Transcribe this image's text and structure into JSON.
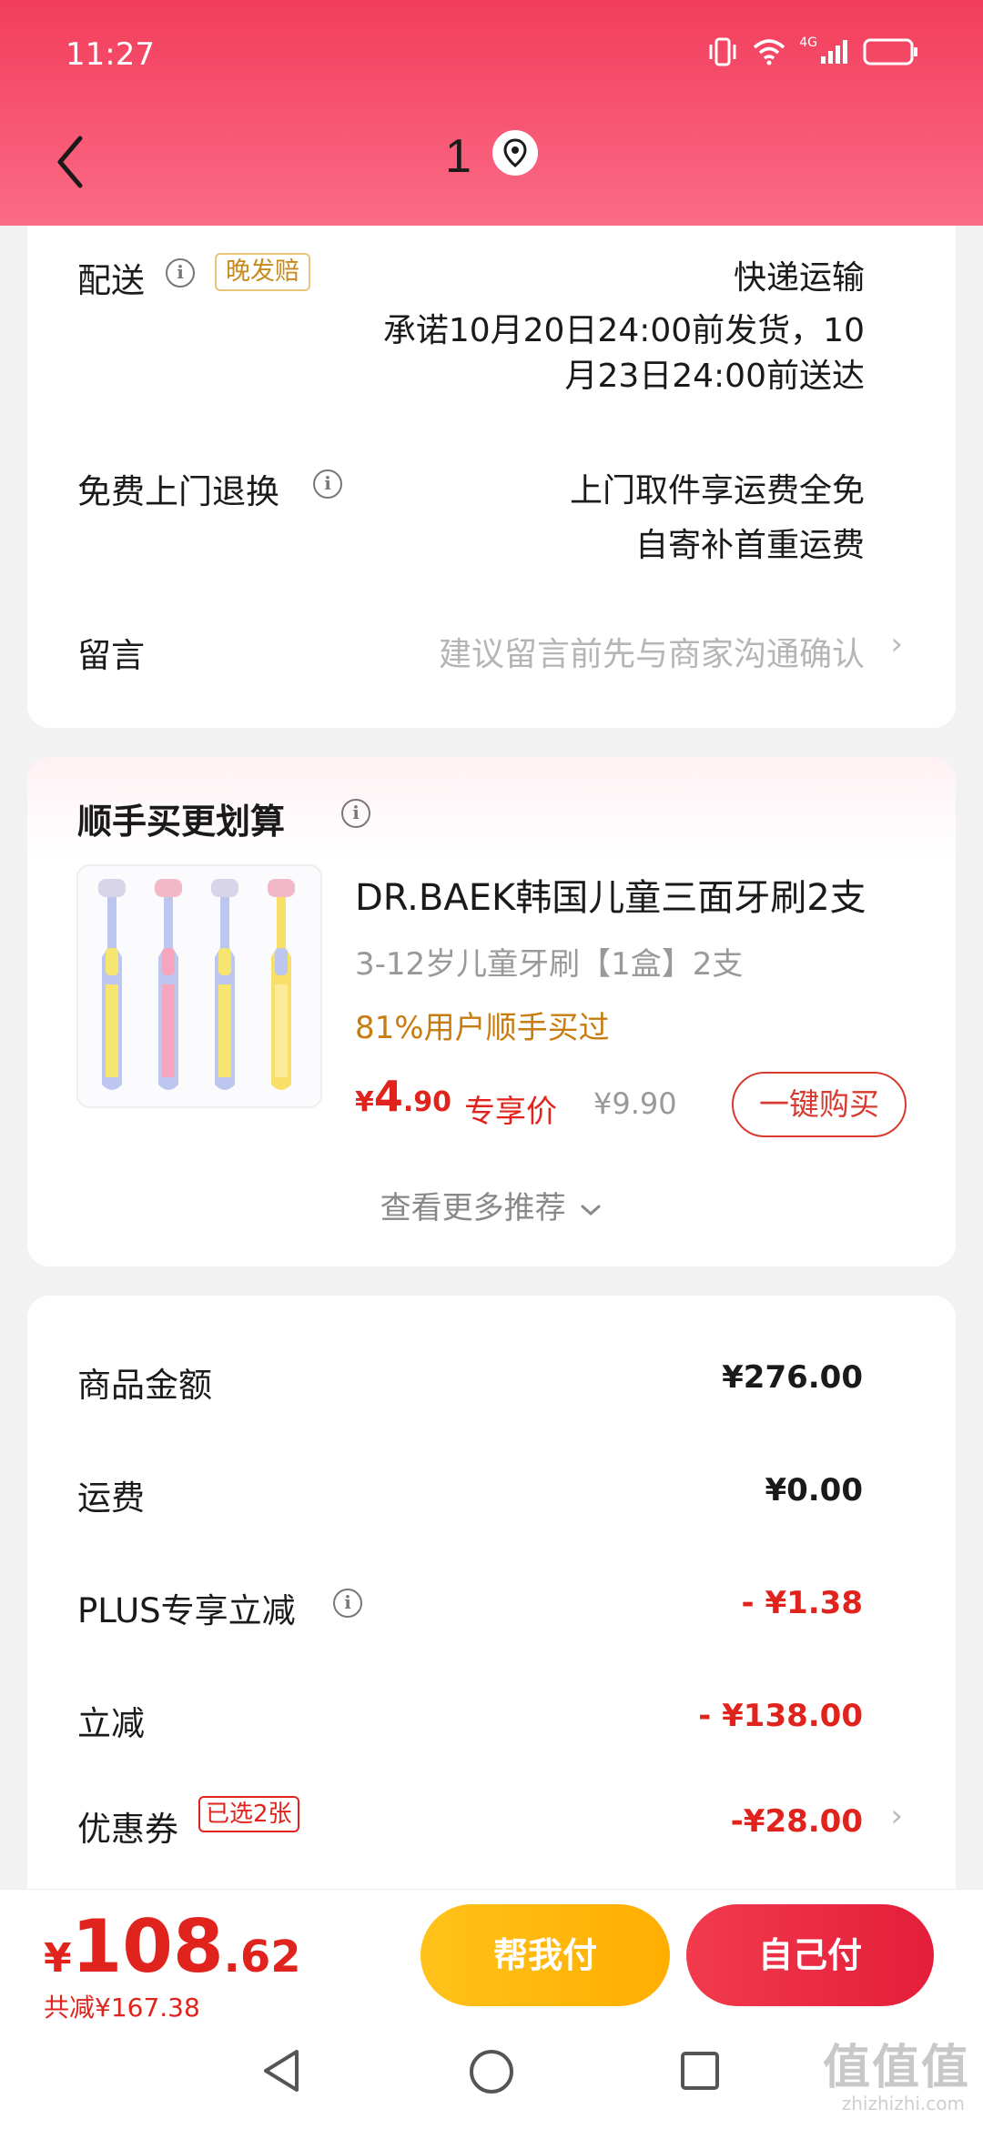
{
  "status_bar": {
    "time": "11:27",
    "network": "4G",
    "icons": [
      "vibrate-icon",
      "wifi-icon",
      "signal-icon",
      "battery-icon"
    ]
  },
  "header": {
    "title": "1",
    "back_icon": "chevron-left-icon",
    "location_icon": "location-pin-icon"
  },
  "delivery": {
    "label": "配送",
    "tag": "晚发赔",
    "method": "快递运输",
    "promise_line1": "承诺10月20日24:00前发货，10",
    "promise_line2": "月23日24:00前送达"
  },
  "returns": {
    "label": "免费上门退换",
    "line1": "上门取件享运费全免",
    "line2": "自寄补首重运费"
  },
  "note": {
    "label": "留言",
    "placeholder": "建议留言前先与商家沟通确认"
  },
  "recommend": {
    "title": "顺手买更划算",
    "product": {
      "title": "DR.BAEK韩国儿童三面牙刷2支",
      "spec": "3-12岁儿童牙刷【1盒】2支",
      "social": "81%用户顺手买过",
      "price_symbol": "¥",
      "price_int": "4",
      "price_dec": ".90",
      "price_tag": "专享价",
      "original_price": "¥9.90",
      "buy_label": "一键购买"
    },
    "more_label": "查看更多推荐"
  },
  "amounts": {
    "goods_label": "商品金额",
    "goods_value": "¥276.00",
    "shipping_label": "运费",
    "shipping_value": "¥0.00",
    "plus_label": "PLUS专享立减",
    "plus_value": "- ¥1.38",
    "discount_label": "立减",
    "discount_value": "- ¥138.00",
    "coupon_label": "优惠券",
    "coupon_tag": "已选2张",
    "coupon_value": "-¥28.00"
  },
  "footer": {
    "price_symbol": "¥",
    "price_int": "108",
    "price_dec": ".62",
    "saved": "共减¥167.38",
    "help_pay": "帮我付",
    "self_pay": "自己付"
  },
  "watermark": {
    "text": "值值值",
    "sub": "zhizhizhi.com"
  },
  "colors": {
    "header_top": "#f23d5b",
    "accent_red": "#e0241d",
    "help_pay_yellow": "#ffb800",
    "tag_gold": "#c88a1e"
  }
}
